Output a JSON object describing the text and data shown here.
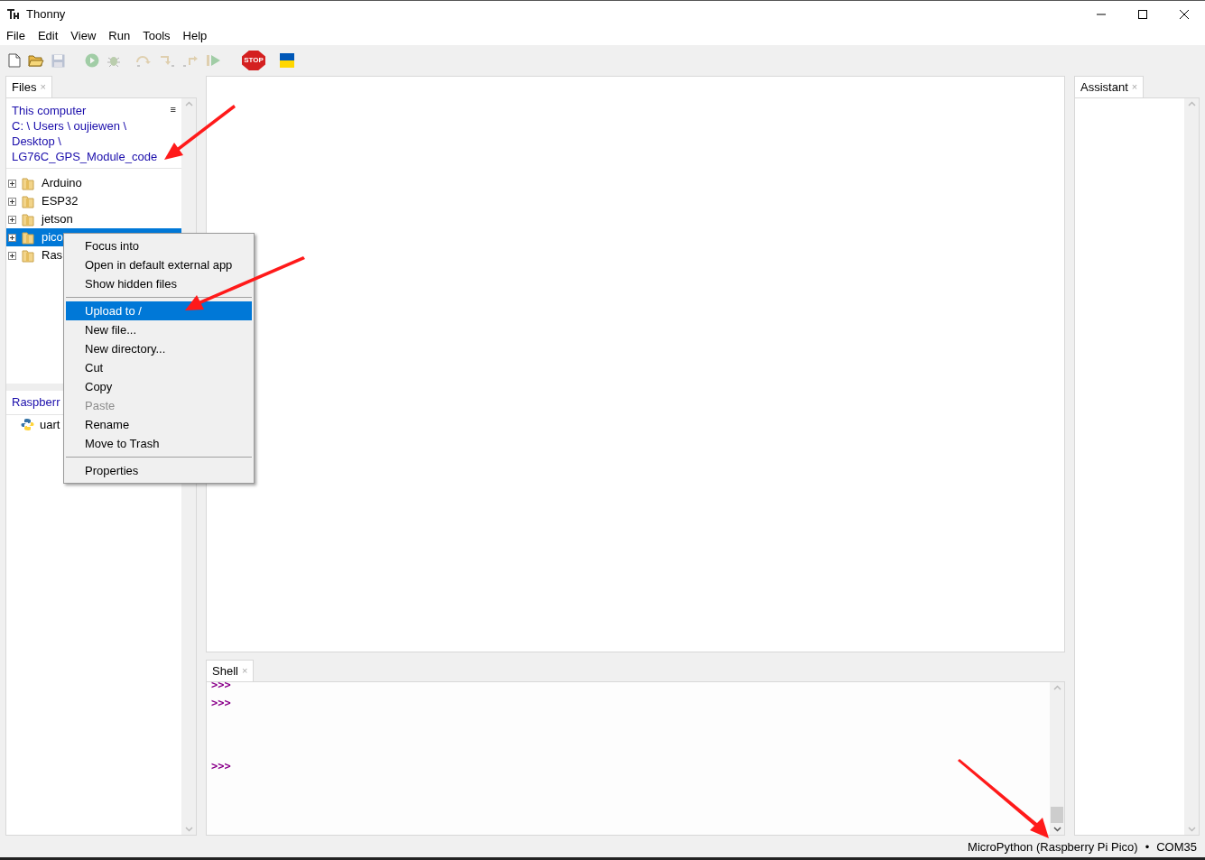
{
  "window": {
    "title": "Thonny"
  },
  "menu_bar": [
    "File",
    "Edit",
    "View",
    "Run",
    "Tools",
    "Help"
  ],
  "toolbar": [
    {
      "kind": "new",
      "disabled": false
    },
    {
      "kind": "open",
      "disabled": false
    },
    {
      "kind": "save",
      "disabled": true
    },
    {
      "kind": "run",
      "disabled": true
    },
    {
      "kind": "debug",
      "disabled": true
    },
    {
      "kind": "step_over",
      "disabled": true
    },
    {
      "kind": "step_into",
      "disabled": true
    },
    {
      "kind": "step_out",
      "disabled": true
    },
    {
      "kind": "resume",
      "disabled": true
    },
    {
      "kind": "stop",
      "disabled": false,
      "label": "STOP"
    },
    {
      "kind": "flag",
      "disabled": false
    }
  ],
  "files_panel": {
    "tab": {
      "label": "Files",
      "close": "×"
    },
    "menu_glyph": "≡",
    "path": [
      "This computer",
      "C: \\ Users \\ oujiewen \\",
      "Desktop \\",
      "LG76C_GPS_Module_code"
    ],
    "items": [
      {
        "name": "Arduino",
        "selected": false
      },
      {
        "name": "ESP32",
        "selected": false
      },
      {
        "name": "jetson",
        "selected": false
      },
      {
        "name": "pico",
        "selected": true
      },
      {
        "name": "Ras",
        "selected": false
      }
    ],
    "device_header": "Raspberr",
    "device_items": [
      {
        "name": "uart"
      }
    ]
  },
  "context_menu": [
    {
      "kind": "item",
      "label": "Focus into",
      "selected": false,
      "disabled": false
    },
    {
      "kind": "item",
      "label": "Open in default external app",
      "selected": false,
      "disabled": false
    },
    {
      "kind": "item",
      "label": "Show hidden files",
      "selected": false,
      "disabled": false
    },
    {
      "kind": "separator"
    },
    {
      "kind": "item",
      "label": "Upload to /",
      "selected": true,
      "disabled": false
    },
    {
      "kind": "item",
      "label": "New file...",
      "selected": false,
      "disabled": false
    },
    {
      "kind": "item",
      "label": "New directory...",
      "selected": false,
      "disabled": false
    },
    {
      "kind": "item",
      "label": "Cut",
      "selected": false,
      "disabled": false
    },
    {
      "kind": "item",
      "label": "Copy",
      "selected": false,
      "disabled": false
    },
    {
      "kind": "item",
      "label": "Paste",
      "selected": false,
      "disabled": true
    },
    {
      "kind": "item",
      "label": "Rename",
      "selected": false,
      "disabled": false
    },
    {
      "kind": "item",
      "label": "Move to Trash",
      "selected": false,
      "disabled": false
    },
    {
      "kind": "separator"
    },
    {
      "kind": "item",
      "label": "Properties",
      "selected": false,
      "disabled": false
    }
  ],
  "shell": {
    "tab": {
      "label": "Shell",
      "close": "×"
    },
    "lines": [
      ">>>",
      ">>>",
      ">>>"
    ]
  },
  "assistant": {
    "tab": {
      "label": "Assistant",
      "close": "×"
    }
  },
  "status_bar": {
    "interpreter": "MicroPython (Raspberry Pi Pico)",
    "separator": "•",
    "port": "COM35"
  }
}
